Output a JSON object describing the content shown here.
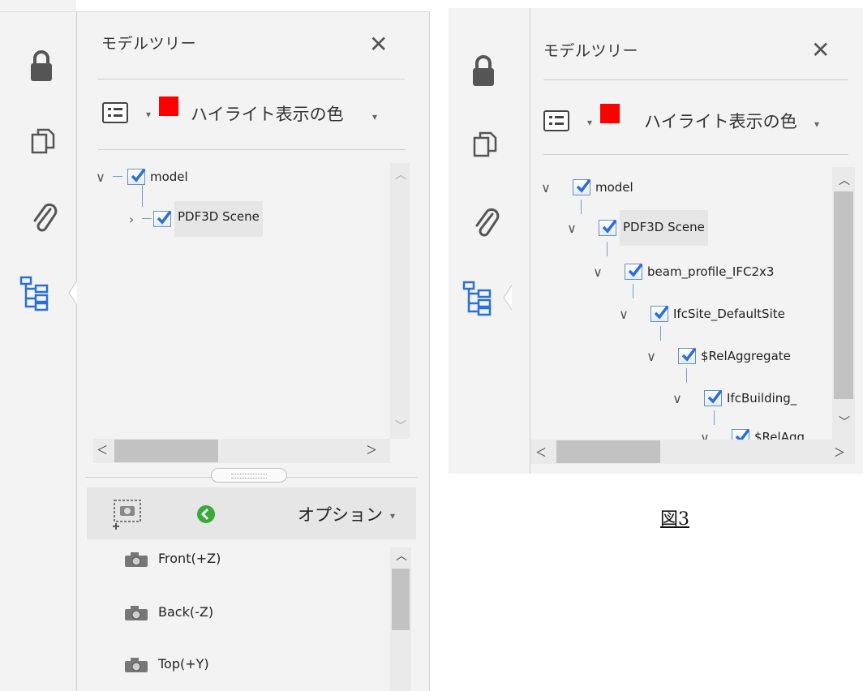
{
  "left_panel": {
    "title": "モデルツリー",
    "close_label": "✕",
    "highlight_label": "ハイライト表示の色",
    "highlight_color": "#ff0000",
    "tree": [
      {
        "label": "model",
        "expanded": true
      },
      {
        "label": "PDF3D Scene",
        "expanded": false,
        "selected": true
      }
    ],
    "views_toolbar": {
      "options_label": "オプション"
    },
    "views": [
      {
        "label": "Front(+Z)"
      },
      {
        "label": "Back(-Z)"
      },
      {
        "label": "Top(+Y)"
      }
    ]
  },
  "right_panel": {
    "title": "モデルツリー",
    "close_label": "✕",
    "highlight_label": "ハイライト表示の色",
    "highlight_color": "#ff0000",
    "tree": [
      {
        "label": "model"
      },
      {
        "label": "PDF3D Scene",
        "selected": true
      },
      {
        "label": "beam_profile_IFC2x3"
      },
      {
        "label": "IfcSite_DefaultSite"
      },
      {
        "label": "$RelAggregate"
      },
      {
        "label": "IfcBuilding_"
      },
      {
        "label": "$RelAgg"
      }
    ]
  },
  "caption": "図3",
  "colors": {
    "accent": "#2a6fd6",
    "panel_bg": "#f3f3f3"
  }
}
